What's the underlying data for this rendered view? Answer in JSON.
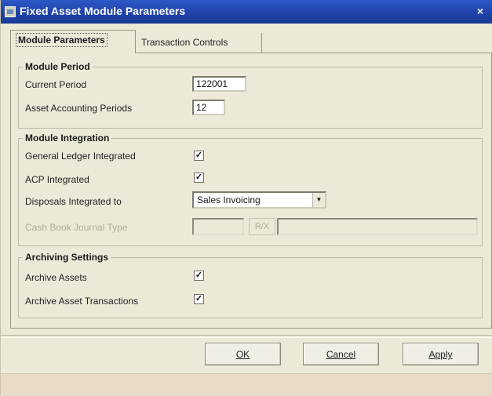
{
  "window": {
    "title": "Fixed Asset Module Parameters",
    "close_glyph": "×"
  },
  "tabs": [
    {
      "label": "Module Parameters",
      "active": true
    },
    {
      "label": "Transaction Controls",
      "active": false
    }
  ],
  "module_period": {
    "legend": "Module Period",
    "current_period_label": "Current Period",
    "current_period_value": "122001",
    "asset_accounting_periods_label": "Asset Accounting Periods",
    "asset_accounting_periods_value": "12"
  },
  "module_integration": {
    "legend": "Module Integration",
    "gl_label": "General Ledger Integrated",
    "gl_checked": true,
    "acp_label": "ACP Integrated",
    "acp_checked": true,
    "disposals_label": "Disposals Integrated to",
    "disposals_value": "Sales Invoicing",
    "cash_book_label": "Cash Book Journal Type",
    "cash_book_button": "R/X"
  },
  "archiving": {
    "legend": "Archiving Settings",
    "archive_assets_label": "Archive Assets",
    "archive_assets_checked": true,
    "archive_transactions_label": "Archive Asset Transactions",
    "archive_transactions_checked": true
  },
  "buttons": {
    "ok": "OK",
    "cancel": "Cancel",
    "apply": "Apply"
  },
  "glyphs": {
    "check": "✓",
    "dropdown_arrow": "▼"
  },
  "colors": {
    "titlebar": "#1f43a8",
    "dialog_bg": "#ece9d8"
  }
}
